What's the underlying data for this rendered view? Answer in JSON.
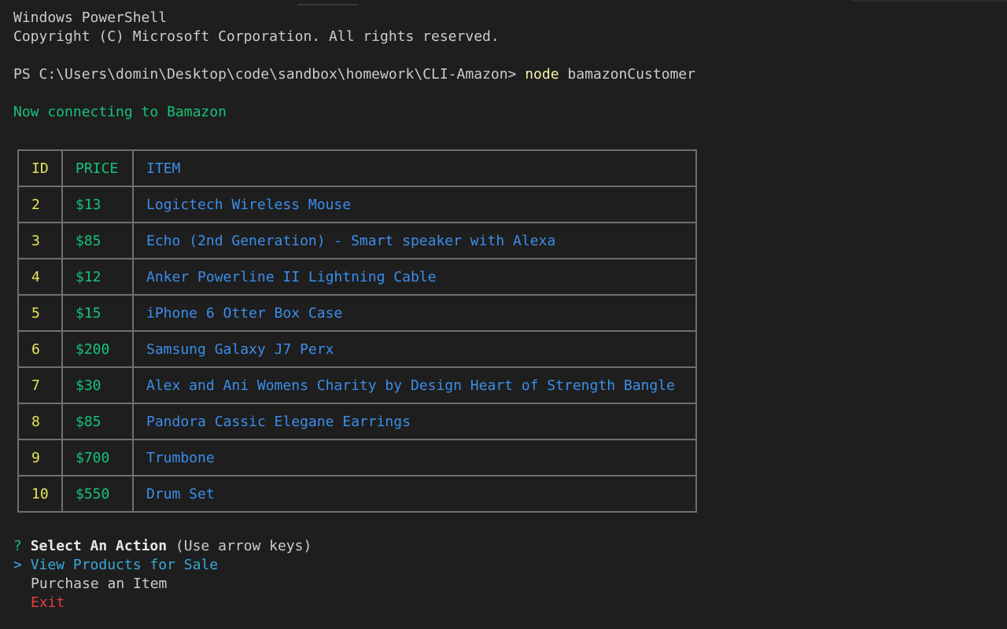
{
  "terminal": {
    "banner_title": "Windows PowerShell",
    "banner_copyright": "Copyright (C) Microsoft Corporation. All rights reserved.",
    "prompt_path": "PS C:\\Users\\domin\\Desktop\\code\\sandbox\\homework\\CLI-Amazon> ",
    "command": "node",
    "command_args": " bamazonCustomer",
    "connecting_message": "Now connecting to Bamazon"
  },
  "table": {
    "headers": [
      "ID",
      "PRICE",
      "ITEM"
    ],
    "rows": [
      {
        "id": "2",
        "price": "$13",
        "item": "Logictech Wireless Mouse"
      },
      {
        "id": "3",
        "price": "$85",
        "item": "Echo (2nd Generation) - Smart speaker with Alexa"
      },
      {
        "id": "4",
        "price": "$12",
        "item": "Anker Powerline II Lightning Cable"
      },
      {
        "id": "5",
        "price": "$15",
        "item": "iPhone 6 Otter Box Case"
      },
      {
        "id": "6",
        "price": "$200",
        "item": "Samsung Galaxy J7 Perx"
      },
      {
        "id": "7",
        "price": "$30",
        "item": "Alex and Ani Womens Charity by Design Heart of Strength Bangle"
      },
      {
        "id": "8",
        "price": "$85",
        "item": "Pandora Cassic Elegane Earrings"
      },
      {
        "id": "9",
        "price": "$700",
        "item": "Trumbone"
      },
      {
        "id": "10",
        "price": "$550",
        "item": "Drum Set"
      }
    ]
  },
  "menu": {
    "question_mark": "?",
    "question": "Select An Action",
    "hint": "(Use arrow keys)",
    "pointer": ">",
    "options": [
      "View Products for Sale",
      "Purchase an Item",
      "Exit"
    ],
    "selected_index": 0
  },
  "colors": {
    "background": "#1e1e1e",
    "text": "#cccccc",
    "command": "#f9f1a5",
    "green": "#16c279",
    "header_red": "#d63a3a",
    "id_yellow": "#e6e65a",
    "item_blue": "#3b8eea",
    "selected_cyan": "#3aa8d8",
    "exit_red": "#e04040"
  }
}
